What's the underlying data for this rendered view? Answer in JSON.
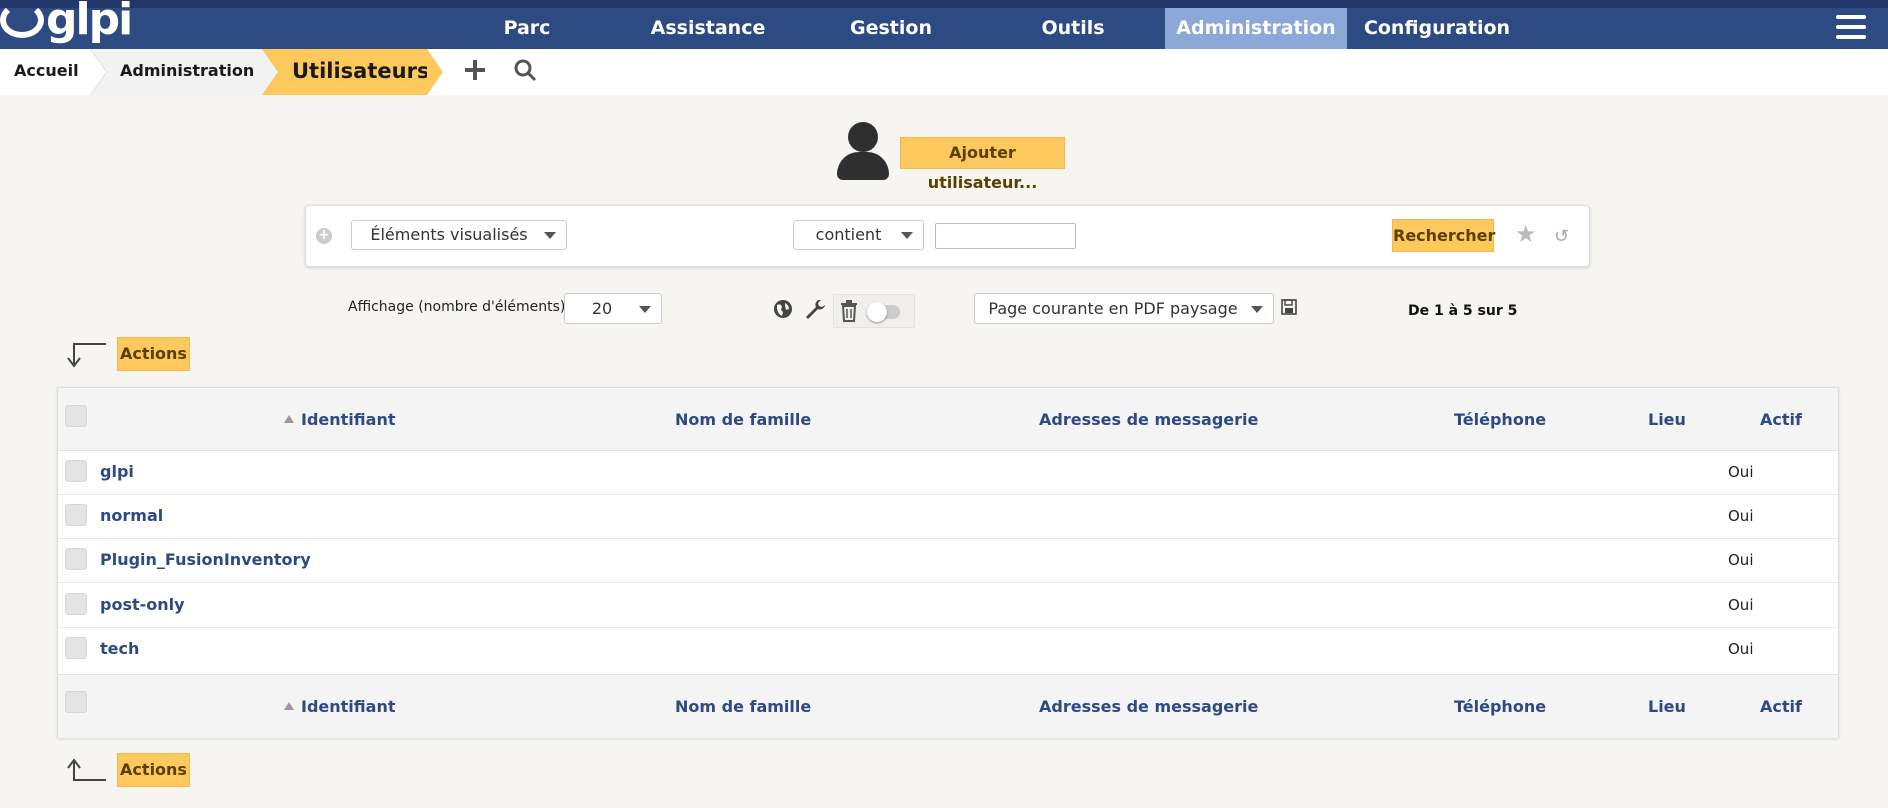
{
  "app": {
    "logo_text": "glpi"
  },
  "nav": {
    "items": [
      {
        "label": "Parc"
      },
      {
        "label": "Assistance"
      },
      {
        "label": "Gestion"
      },
      {
        "label": "Outils"
      },
      {
        "label": "Administration",
        "active": true
      },
      {
        "label": "Configuration"
      }
    ]
  },
  "breadcrumb": [
    "Accueil",
    "Administration",
    "Utilisateurs"
  ],
  "add_user": {
    "label": "Ajouter utilisateur..."
  },
  "search": {
    "field": "Éléments visualisés",
    "operator": "contient",
    "value": "",
    "submit_label": "Rechercher"
  },
  "display": {
    "label": "Affichage (nombre d'éléments)",
    "per_page": "20",
    "export": "Page courante en PDF paysage",
    "count": "De 1 à 5 sur 5"
  },
  "actions_label": "Actions",
  "table": {
    "columns": [
      "Identifiant",
      "Nom de famille",
      "Adresses de messagerie",
      "Téléphone",
      "Lieu",
      "Actif"
    ],
    "rows": [
      {
        "identifiant": "glpi",
        "actif": "Oui"
      },
      {
        "identifiant": "normal",
        "actif": "Oui"
      },
      {
        "identifiant": "Plugin_FusionInventory",
        "actif": "Oui"
      },
      {
        "identifiant": "post-only",
        "actif": "Oui"
      },
      {
        "identifiant": "tech",
        "actif": "Oui"
      }
    ]
  },
  "colors": {
    "nav_bg": "#2e4a82",
    "nav_active": "#8ba8d8",
    "accent": "#fec95c",
    "link": "#2e4a82"
  }
}
